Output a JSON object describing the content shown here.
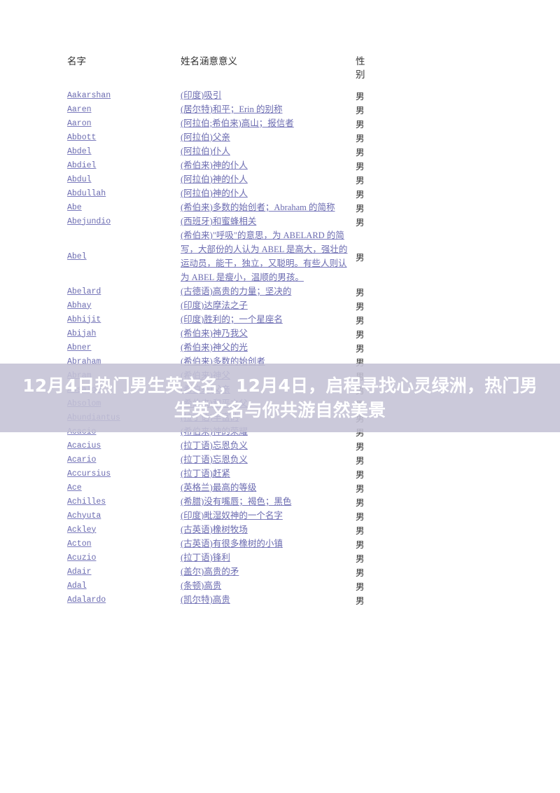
{
  "page": {
    "background": "#ffffff",
    "link_color": "#6b6bb0",
    "text_color": "#2b2b2b"
  },
  "table": {
    "headers": {
      "name": "名字",
      "meaning": "姓名涵意意义",
      "gender": "性别"
    },
    "rows": [
      {
        "name": "Aakarshan",
        "meaning": "(印度)吸引",
        "gender": "男"
      },
      {
        "name": "Aaren",
        "meaning": "(居尔特)和平；Erin 的别称",
        "gender": "男"
      },
      {
        "name": "Aaron",
        "meaning": "(阿拉伯;希伯来)高山；报信者",
        "gender": "男"
      },
      {
        "name": "Abbott",
        "meaning": "(阿拉伯)父亲",
        "gender": "男"
      },
      {
        "name": "Abdel",
        "meaning": "(阿拉伯)仆人",
        "gender": "男"
      },
      {
        "name": "Abdiel",
        "meaning": "(希伯来)神的仆人",
        "gender": "男"
      },
      {
        "name": "Abdul",
        "meaning": "(阿拉伯)神的仆人",
        "gender": "男"
      },
      {
        "name": "Abdullah",
        "meaning": "(阿拉伯)神的仆人",
        "gender": "男"
      },
      {
        "name": "Abe",
        "meaning": "(希伯来)多数的始创者；Abraham 的简称",
        "gender": "男"
      },
      {
        "name": "Abejundio",
        "meaning": "(西班牙)和蜜蜂相关",
        "gender": "男"
      },
      {
        "name": "Abel",
        "meaning": "(希伯来)\"呼吸\"的意思，为 ABELARD 的简写，大部份的人认为 ABEL 是高大，强壮的运动员，能干，独立，又聪明。有些人则认为 ABEL 是瘦小，温顺的男孩。",
        "gender": "男",
        "tall": true
      },
      {
        "name": "Abelard",
        "meaning": "(古德语)高贵的力量；坚决的",
        "gender": "男"
      },
      {
        "name": "Abhay",
        "meaning": "(印度)达摩法之子",
        "gender": "男"
      },
      {
        "name": "Abhijit",
        "meaning": "(印度)胜利的；一个星座名",
        "gender": "男"
      },
      {
        "name": "Abijah",
        "meaning": "(希伯来)神乃我父",
        "gender": "男"
      },
      {
        "name": "Abner",
        "meaning": "(希伯来)神父的光",
        "gender": "男"
      },
      {
        "name": "Abraham",
        "meaning": "(希伯来)多数的始创者",
        "gender": "男"
      },
      {
        "name": "Abram",
        "meaning": "(希伯来)神父",
        "gender": "男"
      },
      {
        "name": "Absalom",
        "meaning": "(希伯来)父亲",
        "gender": "男"
      },
      {
        "name": "Absolom",
        "meaning": "(希伯来)和平之父",
        "gender": "男"
      },
      {
        "name": "Abundiantus",
        "meaning": "(拉丁语)丰富的",
        "gender": "男"
      },
      {
        "name": "Acacio",
        "meaning": "(希伯来)神的荣耀",
        "gender": "男"
      },
      {
        "name": "Acacius",
        "meaning": "(拉丁语)忘恩负义",
        "gender": "男"
      },
      {
        "name": "Acario",
        "meaning": "(拉丁语)忘恩负义",
        "gender": "男"
      },
      {
        "name": "Accursius",
        "meaning": "(拉丁语)赶紧",
        "gender": "男"
      },
      {
        "name": "Ace",
        "meaning": "(英格兰)最高的等级",
        "gender": "男"
      },
      {
        "name": "Achilles",
        "meaning": "(希腊)没有嘴唇；褐色；黑色",
        "gender": "男"
      },
      {
        "name": "Achyuta",
        "meaning": "(印度)毗湿奴神的一个名字",
        "gender": "男"
      },
      {
        "name": "Ackley",
        "meaning": "(古英语)橡树牧场",
        "gender": "男"
      },
      {
        "name": "Acton",
        "meaning": "(古英语)有很多橡树的小镇",
        "gender": "男"
      },
      {
        "name": "Acuzio",
        "meaning": "(拉丁语)锋利",
        "gender": "男"
      },
      {
        "name": "Adair",
        "meaning": "(盖尔)高贵的矛",
        "gender": "男"
      },
      {
        "name": "Adal",
        "meaning": "(条顿)高贵",
        "gender": "男"
      },
      {
        "name": "Adalardo",
        "meaning": "(凯尔特)高贵",
        "gender": "男"
      }
    ]
  },
  "overlay": {
    "text": "12月4日热门男生英文名，12月4日，启程寻找心灵绿洲，热门男生英文名与你共游自然美景",
    "background": "#c4c1d5",
    "text_color": "#ffffff"
  }
}
